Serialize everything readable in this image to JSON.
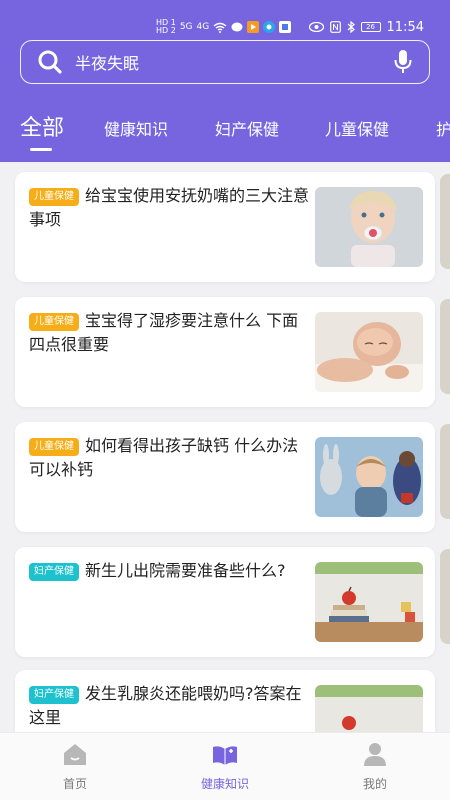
{
  "status_bar": {
    "time": "11:54",
    "battery": "26",
    "network_1": "HD 1",
    "network_2": "HD 2",
    "signal": "5G",
    "signal2": "4G"
  },
  "search": {
    "placeholder": "半夜失眠"
  },
  "tabs": [
    {
      "label": "全部"
    },
    {
      "label": "健康知识"
    },
    {
      "label": "妇产保健"
    },
    {
      "label": "儿童保健"
    },
    {
      "label": "护"
    }
  ],
  "articles": [
    {
      "tag": "儿童保健",
      "title": "给宝宝使用安抚奶嘴的三大注意事项"
    },
    {
      "tag": "儿童保健",
      "title": "宝宝得了湿疹要注意什么 下面四点很重要"
    },
    {
      "tag": "儿童保健",
      "title": "如何看得出孩子缺钙 什么办法可以补钙"
    },
    {
      "tag": "妇产保健",
      "title": "新生儿出院需要准备些什么?"
    },
    {
      "tag": "妇产保健",
      "title": "发生乳腺炎还能喂奶吗?答案在这里"
    }
  ],
  "bottom_nav": [
    {
      "label": "首页"
    },
    {
      "label": "健康知识"
    },
    {
      "label": "我的"
    }
  ],
  "colors": {
    "brand": "#7764df",
    "badge_child": "#f5ae17",
    "badge_maternal": "#1ec2cf"
  }
}
